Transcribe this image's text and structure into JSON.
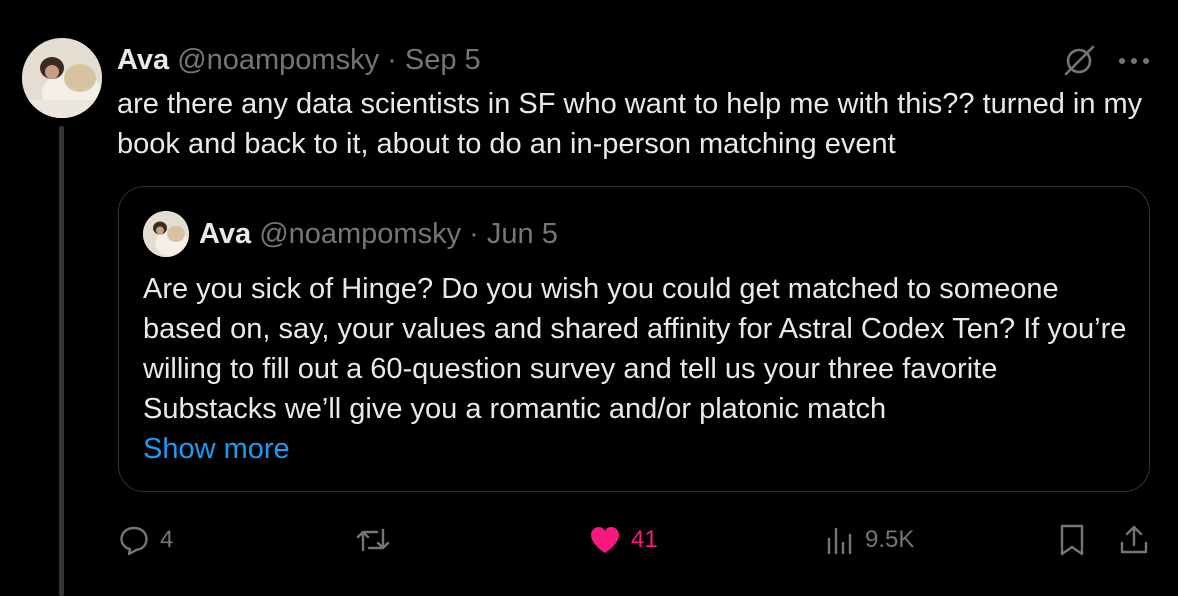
{
  "tweet": {
    "author_name": "Ava",
    "handle": "@noampomsky",
    "separator": "·",
    "date": "Sep 5",
    "text": "are there any data scientists in SF who want to help me with this?? turned in my book and back to it, about to do an in-person matching event"
  },
  "quoted_tweet": {
    "author_name": "Ava",
    "handle": "@noampomsky",
    "separator": "·",
    "date": "Jun 5",
    "text": "Are you sick of Hinge? Do you wish you could get matched to someone based on, say, your values and shared affinity for Astral Codex Ten? If you’re willing to fill out a 60-question survey and tell us your three favorite Substacks we’ll give you a romantic and/or platonic match",
    "show_more": "Show more"
  },
  "actions": {
    "replies": "4",
    "reposts": "",
    "likes": "41",
    "views": "9.5K"
  },
  "icons": [
    "grok-icon",
    "more-icon",
    "reply-icon",
    "repost-icon",
    "like-icon",
    "views-icon",
    "bookmark-icon",
    "share-icon"
  ],
  "colors": {
    "background": "#000000",
    "text": "#e7e9ea",
    "muted": "#71767b",
    "link": "#1d9bf0",
    "like": "#f91880",
    "border": "#2f3336"
  }
}
